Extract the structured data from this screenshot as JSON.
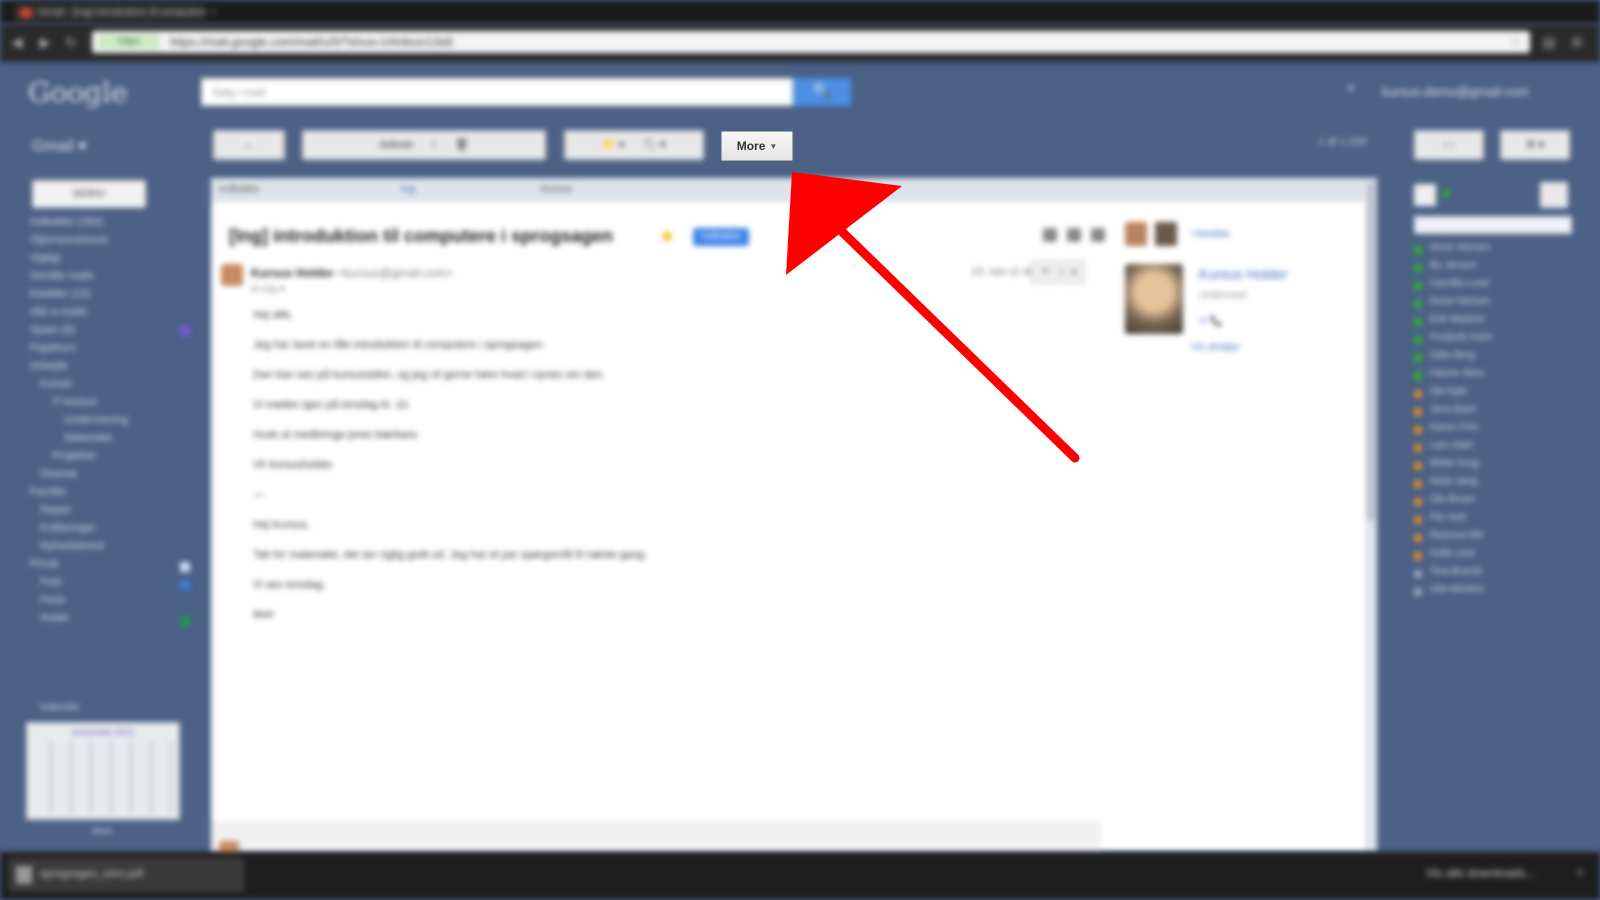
{
  "browser": {
    "tab_title": "Gmail - [Ing] introduktion til computere",
    "url": "https://mail.google.com/mail/u/0/?shva=1#inbox/13a5",
    "secure_label": "https"
  },
  "header": {
    "logo": "Google",
    "search_placeholder": "Søg i mail",
    "search_icon": "🔍",
    "account": "kursus.demo@gmail.com",
    "share_icon": "+"
  },
  "toolbar": {
    "gmail_label": "Gmail ▾",
    "back": "←",
    "archive": "Arkivér",
    "spam": "!",
    "delete": "🗑",
    "move": "📁 ▾",
    "labels": "🏷 ▾",
    "more_label": "More",
    "pager": "1 af 1.234",
    "prev_next": "‹ ›",
    "settings": "⚙ ▾"
  },
  "sidebar": {
    "compose": "SKRIV",
    "items": [
      "Indbakke (284)",
      "Stjernemarkeret",
      "Vigtigt",
      "Sendte mails",
      "Kladder (12)",
      "Alle e-mails",
      "Spam (6)",
      "Papirkurv",
      "Arbejde",
      "Kurser",
      "IT-kursus",
      "Undervisning",
      "Materialer",
      "Projekter",
      "Diverse",
      "Familie",
      "Rejser",
      "Kvitteringer",
      "Nyhedsbreve",
      "Privat",
      "Foto",
      "Ferie",
      "Andet"
    ],
    "calendar_title": "Kalender",
    "calendar_month": "november 2012",
    "calendar_footer": "Mere"
  },
  "message": {
    "breadcrumbs": [
      "Indbakke",
      "Ing",
      "Kursus"
    ],
    "subject": "[Ing] introduktion til computere i sprogsagen",
    "label_chip": "Indbakke",
    "sender_name": "Kursus Holder",
    "sender_email": "<kursus@gmail.com>",
    "to": "til mig ▾",
    "date": "13. nov (1 dag siden)",
    "reply": "↩",
    "reply_more": "▾",
    "body": [
      "Hej alle,",
      "Jeg har lavet en lille introduktion til computere i sprogsagen.",
      "Den kan ses på kursussiden, og jeg vil gerne høre hvad I synes om den.",
      "Vi mødes igen på torsdag kl. 10.",
      "Husk at medbringe jeres bærbare.",
      "Vh kursusholder",
      "—",
      "Hej Kursus,",
      "Tak for materialet, det ser rigtig godt ud. Jeg har et par spørgsmål til næste gang.",
      "Vi ses torsdag.",
      "Mvh"
    ]
  },
  "people": {
    "in_circles": "i kredse",
    "name": "Kursus Holder",
    "title": "Underviser",
    "icons": "✉ 📞",
    "link": "Vis detaljer"
  },
  "chat": {
    "contacts": [
      "Anne Hansen",
      "Bo Jensen",
      "Camilla Lund",
      "Dorte Nielsen",
      "Erik Madsen",
      "Frederik Holm",
      "Gitte Berg",
      "Hanne Skov",
      "Ida Kjær",
      "Jens Bach",
      "Karen Friis",
      "Lars Dahl",
      "Mette Krog",
      "Niels Vang",
      "Ole Bruun",
      "Pia Juul",
      "Rasmus Ahl",
      "Sofie Lind",
      "Tina Brandt",
      "Ulla Winther"
    ]
  },
  "downloads": {
    "file": "sprogsagen_intro.pdf",
    "show_all": "Vis alle downloads...",
    "close": "×"
  },
  "colors": {
    "app_bg": "#4b6186",
    "accent_blue": "#4d8fe3",
    "annotation_arrow": "#ff0000"
  }
}
